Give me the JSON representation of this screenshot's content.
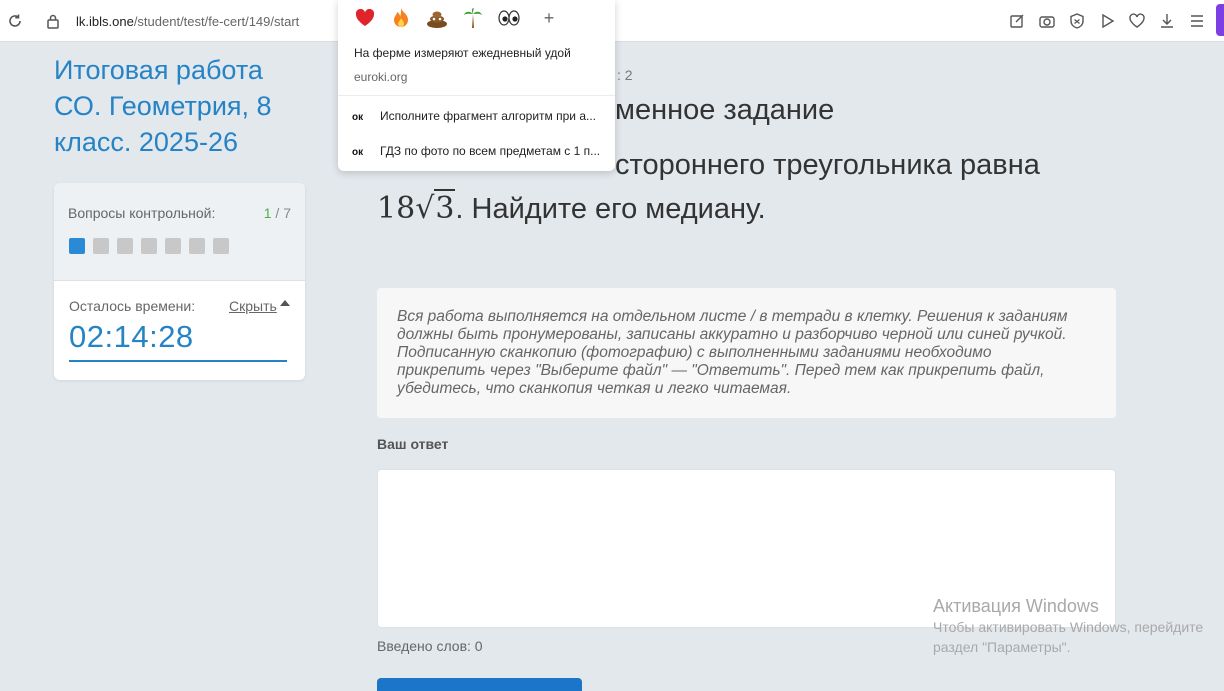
{
  "browser": {
    "url_host": "lk.ibls.one",
    "url_path": "/student/test/fe-cert/149/start"
  },
  "sidebar": {
    "test_title": "Итоговая работа СО. Геометрия, 8 класс. 2025-26",
    "questions_label": "Вопросы контрольной:",
    "questions_current": "1",
    "questions_total": "/ 7",
    "time_label": "Осталось времени:",
    "hide_label": "Скрыть",
    "timer": "02:14:28"
  },
  "main": {
    "task_meta": ": 2",
    "task_type": "менное задание",
    "task_text_line1": "стороннего треугольника равна",
    "math_coef": "18",
    "math_sqrt": "3",
    "task_text_line2": ". Найдите его медиану.",
    "info_text": "Вся работа выполняется на отдельном листе / в тетради в клетку. Решения к заданиям должны быть пронумерованы, записаны аккуратно и разборчиво черной или синей ручкой. Подписанную сканкопию (фотографию) с выполненными заданиями необходимо прикрепить через \"Выберите файл\" — \"Ответить\". Перед тем как прикрепить файл, убедитесь, что сканкопия четкая и легко читаемая.",
    "answer_label": "Ваш ответ",
    "word_count": "Введено слов: 0"
  },
  "popup": {
    "emoji_icons": [
      "heart-icon",
      "fire-icon",
      "poop-icon",
      "palm-tree-icon",
      "eyes-icon"
    ],
    "add_label": "+",
    "title": "На ферме измеряют ежедневный удой",
    "source": "euroki.org",
    "items": [
      {
        "badge": "ок",
        "text": "Исполните фрагмент алгоритм при а..."
      },
      {
        "badge": "ок",
        "text": "ГДЗ по фото по всем предметам с 1 п..."
      }
    ]
  },
  "watermark": {
    "title": "Активация Windows",
    "line1": "Чтобы активировать Windows, перейдите",
    "line2": "раздел \"Параметры\"."
  },
  "colors": {
    "accent": "#2583c6",
    "active_question": "#2b8ad6",
    "submit": "#1b75c8",
    "background": "#e3e8ed"
  }
}
